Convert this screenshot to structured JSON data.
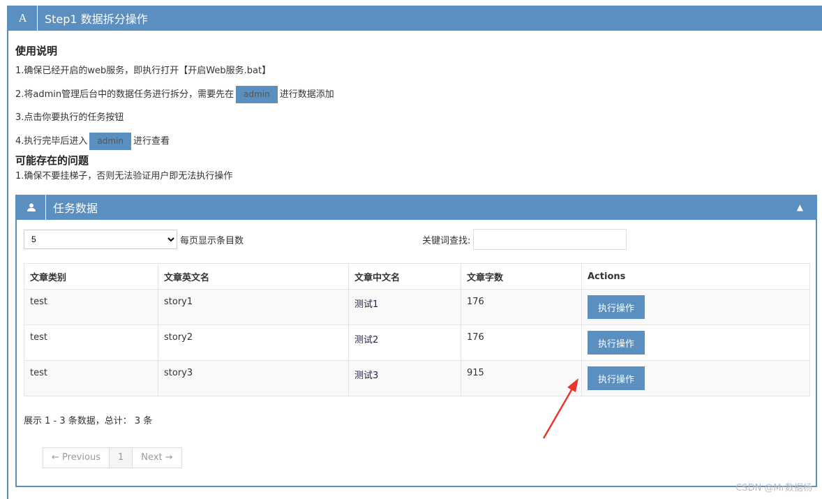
{
  "panel": {
    "icon": "A",
    "title": "Step1 数据拆分操作"
  },
  "instructions": {
    "heading": "使用说明",
    "step1": "1.确保已经开启的web服务，即执行打开【开启Web服务.bat】",
    "step2_pre": "2.将admin管理后台中的数据任务进行拆分，需要先在",
    "step2_btn": "admin",
    "step2_post": "进行数据添加",
    "step3": "3.点击你要执行的任务按钮",
    "step4_pre": "4.执行完毕后进入",
    "step4_btn": "admin",
    "step4_post": "进行查看"
  },
  "issues": {
    "heading": "可能存在的问题",
    "item1": "1.确保不要挂梯子，否则无法验证用户即无法执行操作"
  },
  "task_panel": {
    "icon": "user-icon",
    "title": "任务数据",
    "page_size": "5",
    "page_size_label": "每页显示条目数",
    "search_label": "关键词查找:",
    "search_value": "",
    "columns": [
      "文章类别",
      "文章英文名",
      "文章中文名",
      "文章字数",
      "Actions"
    ],
    "rows": [
      {
        "category": "test",
        "en": "story1",
        "zh": "测试1",
        "count": "176",
        "action": "执行操作"
      },
      {
        "category": "test",
        "en": "story2",
        "zh": "测试2",
        "count": "176",
        "action": "执行操作"
      },
      {
        "category": "test",
        "en": "story3",
        "zh": "测试3",
        "count": "915",
        "action": "执行操作"
      }
    ],
    "info": "展示 1 - 3 条数据，总计： 3 条",
    "pager": {
      "prev": "← Previous",
      "current": "1",
      "next": "Next →"
    }
  },
  "watermark": "CSDN @Mr数据杨",
  "colors": {
    "accent": "#5a8fbf",
    "arrow": "#e8382b"
  }
}
